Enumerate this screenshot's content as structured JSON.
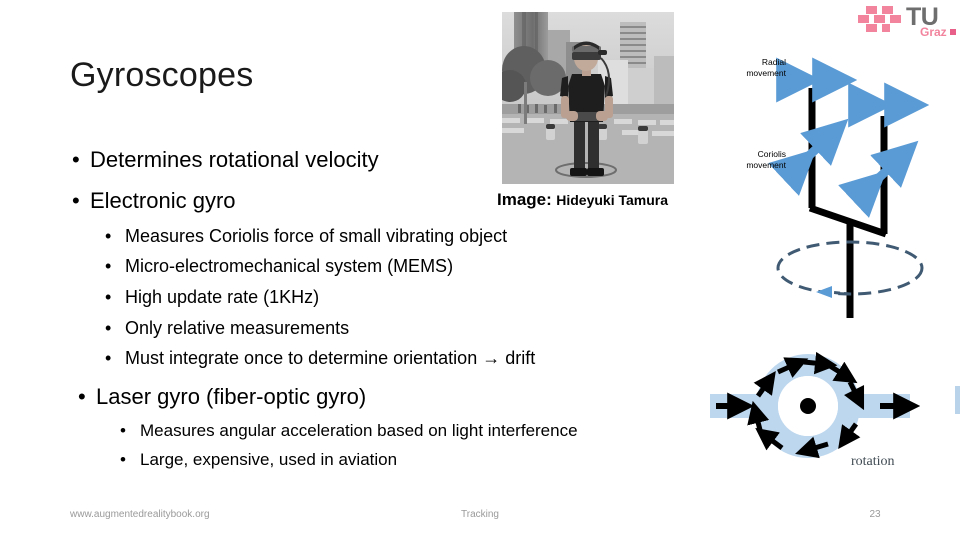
{
  "slide": {
    "title": "Gyroscopes",
    "page_number": "23"
  },
  "logo": {
    "name": "tu-graz-logo",
    "line1": "TU",
    "line2": "Graz",
    "mark_color": "#f2849e",
    "text_color": "#6e6e6e"
  },
  "bullets": {
    "level1": [
      {
        "marker": "•",
        "text": "Determines rotational velocity"
      },
      {
        "marker": "•",
        "text": "Electronic gyro"
      },
      {
        "marker": "•",
        "text": "Laser gyro (fiber-optic gyro)"
      }
    ],
    "electronic_gyro_sub": [
      {
        "marker": "•",
        "text": "Measures Coriolis force of small vibrating object"
      },
      {
        "marker": "•",
        "text": "Micro-electromechanical system (MEMS)"
      },
      {
        "marker": "•",
        "text": "High update rate (1KHz)"
      },
      {
        "marker": "•",
        "text": "Only relative measurements"
      },
      {
        "marker": "•",
        "text": "Must integrate once to determine orientation → drift"
      }
    ],
    "laser_gyro_sub": [
      {
        "marker": "•",
        "text": "Measures angular acceleration based on light interference"
      },
      {
        "marker": "•",
        "text": "Large, expensive, used in aviation"
      }
    ]
  },
  "photo": {
    "alt": "person wearing augmented reality head-mounted display in an urban plaza",
    "caption_label": "Image:",
    "caption_credit": "Hideyuki Tamura"
  },
  "diagrams": {
    "tuning_fork": {
      "name": "tuning-fork-gyroscope-diagram",
      "label_radial_line1": "Radial",
      "label_radial_line2": "movement",
      "label_coriolis_line1": "Coriolis",
      "label_coriolis_line2": "movement",
      "arrow_color": "#5b9bd5",
      "fork_color": "#000000"
    },
    "ring_gyro": {
      "name": "fiber-optic-ring-gyro-diagram",
      "label_rotation": "rotation",
      "ring_color": "#bdd7ee",
      "arrow_color": "#000000"
    }
  },
  "footer": {
    "url": "www.augmentedrealitybook.org",
    "section": "Tracking",
    "page": "23"
  }
}
